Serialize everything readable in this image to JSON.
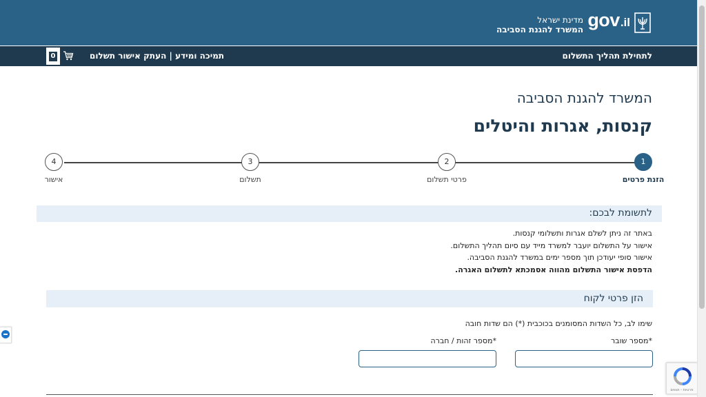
{
  "header": {
    "gov_logo_main": "gov",
    "gov_logo_suffix": ".il",
    "state_name": "מדינת ישראל",
    "ministry_name": "המשרד להגנת הסביבה",
    "brand_color": "#2a6186",
    "emblem_icon": "menorah-emblem-icon"
  },
  "nav": {
    "start_link": "לתחילת תהליך התשלום",
    "support_link": "תמיכה ומידע | העתק אישור תשלום",
    "cart_count": "0",
    "cart_icon": "cart-icon",
    "bar_color": "#1f3a4f"
  },
  "main": {
    "ministry_title": "המשרד להגנת הסביבה",
    "page_title": "קנסות, אגרות והיטלים"
  },
  "stepper": {
    "steps": [
      {
        "number": "1",
        "label": "הזנת פרטים",
        "active": true
      },
      {
        "number": "2",
        "label": "פרטי תשלום",
        "active": false
      },
      {
        "number": "3",
        "label": "תשלום",
        "active": false
      },
      {
        "number": "4",
        "label": "אישור",
        "active": false
      }
    ]
  },
  "notice": {
    "title": "לתשומת לבכם:",
    "lines": [
      "באתר זה ניתן לשלם אגרות ותשלומי קנסות.",
      "אישור על התשלום יועבר למשרד מייד עם סיום תהליך התשלום.",
      "אישור סופי יעודכן תוך מספר ימים במשרד להגנת הסביבה.",
      "הדפסת אישור התשלום מהווה אסמכתא לתשלום האגרה."
    ]
  },
  "customer": {
    "title": "הזן פרטי לקוח",
    "required_note": "שימו לב, כל השדות המסומנים בכוכבית (*) הם שדות חובה",
    "fields": [
      {
        "label": "מספר שובר",
        "value": ""
      },
      {
        "label": "מספר זהות / חברה",
        "value": ""
      }
    ],
    "required_marker": "*"
  },
  "widgets": {
    "recaptcha_icon": "recaptcha-icon",
    "recaptcha_text": "פרטיות - תנאים",
    "side_widget_icon": "remote-support-icon"
  }
}
